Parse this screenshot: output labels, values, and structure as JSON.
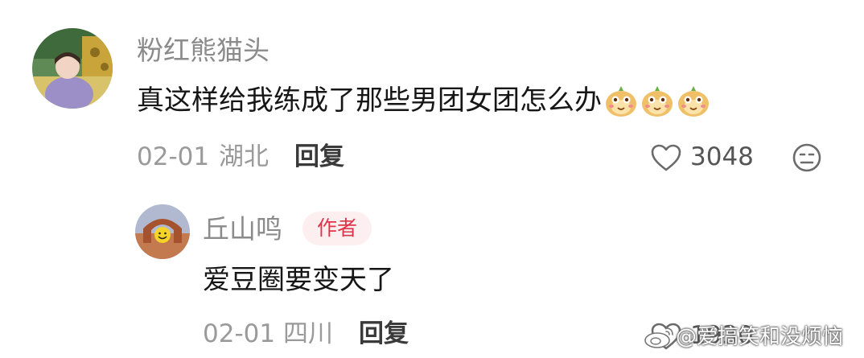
{
  "comment": {
    "username": "粉红熊猫头",
    "text": "真这样给我练成了那些男团女团怎么办",
    "emojis": [
      "monkey-face-emoji",
      "monkey-face-emoji",
      "monkey-face-emoji"
    ],
    "date": "02-01",
    "location": "湖北",
    "reply_label": "回复",
    "like_count": "3048"
  },
  "reply": {
    "username": "丘山鸣",
    "badge": "作者",
    "text": "爱豆圈要变天了",
    "date": "02-01",
    "location": "四川",
    "reply_label": "回复",
    "like_count": "1930"
  },
  "watermark": "@爱搞笑和没烦恼",
  "colors": {
    "badge_text": "#e0344a",
    "badge_bg": "#fdeef0",
    "meta": "#9a9a9a"
  }
}
